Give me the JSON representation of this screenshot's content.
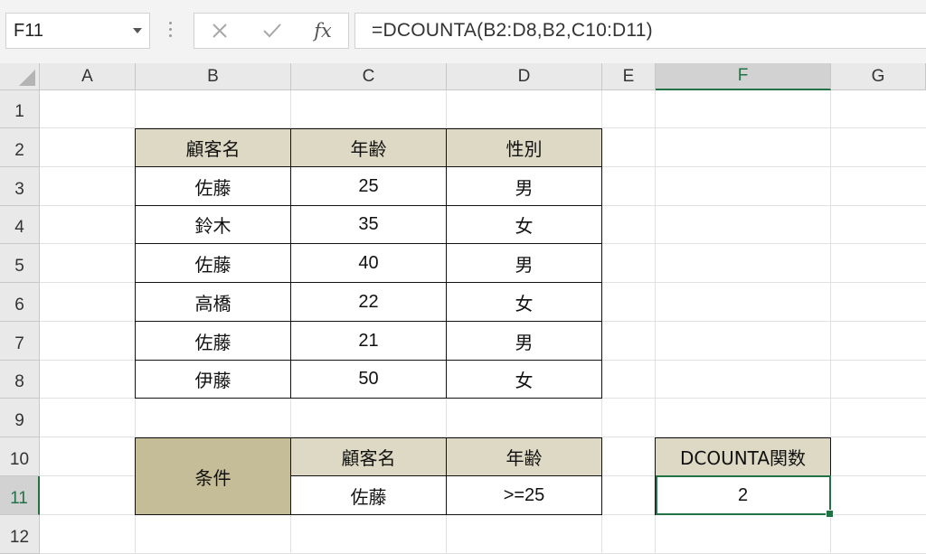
{
  "name_box": {
    "value": "F11"
  },
  "formula_bar": {
    "cancel_icon": "close-icon",
    "enter_icon": "check-icon",
    "fx_label": "fx",
    "formula": "=DCOUNTA(B2:D8,B2,C10:D11)"
  },
  "columns": [
    "A",
    "B",
    "C",
    "D",
    "E",
    "F",
    "G"
  ],
  "active_column": "F",
  "rows": [
    "1",
    "2",
    "3",
    "4",
    "5",
    "6",
    "7",
    "8",
    "9",
    "10",
    "11",
    "12"
  ],
  "active_row": "11",
  "table": {
    "headers": [
      "顧客名",
      "年齢",
      "性別"
    ],
    "rows": [
      [
        "佐藤",
        "25",
        "男"
      ],
      [
        "鈴木",
        "35",
        "女"
      ],
      [
        "佐藤",
        "40",
        "男"
      ],
      [
        "高橋",
        "22",
        "女"
      ],
      [
        "佐藤",
        "21",
        "男"
      ],
      [
        "伊藤",
        "50",
        "女"
      ]
    ]
  },
  "criteria": {
    "label": "条件",
    "headers": [
      "顧客名",
      "年齢"
    ],
    "values": [
      "佐藤",
      ">=25"
    ]
  },
  "result": {
    "label": "DCOUNTA関数",
    "value": "2"
  },
  "colors": {
    "header_fill": "#ddd9c4",
    "criteria_label_fill": "#c4bd97",
    "selection": "#217346"
  }
}
